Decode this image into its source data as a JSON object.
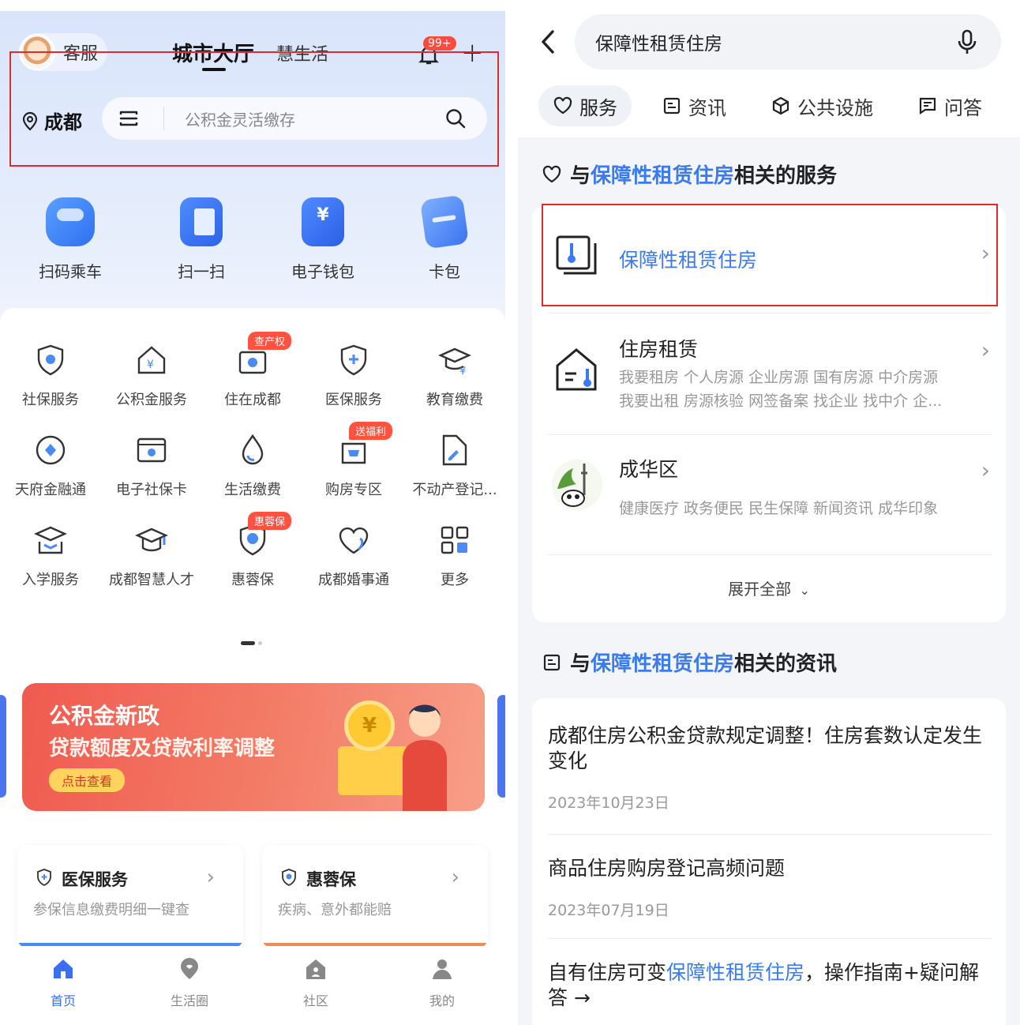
{
  "left": {
    "kefu_label": "客服",
    "tabs": {
      "city": "城市大厅",
      "life": "慧生活"
    },
    "badge": "99+",
    "city": "成都",
    "search_placeholder": "公积金灵活缴存",
    "quick": [
      "扫码乘车",
      "扫一扫",
      "电子钱包",
      "卡包"
    ],
    "grid": [
      [
        {
          "label": "社保服务"
        },
        {
          "label": "公积金服务"
        },
        {
          "label": "住在成都",
          "badge": "查产权"
        },
        {
          "label": "医保服务"
        },
        {
          "label": "教育缴费"
        }
      ],
      [
        {
          "label": "天府金融通"
        },
        {
          "label": "电子社保卡"
        },
        {
          "label": "生活缴费"
        },
        {
          "label": "购房专区",
          "badge": "送福利"
        },
        {
          "label": "不动产登记..."
        }
      ],
      [
        {
          "label": "入学服务"
        },
        {
          "label": "成都智慧人才"
        },
        {
          "label": "惠蓉保",
          "badge": "惠蓉保"
        },
        {
          "label": "成都婚事通"
        },
        {
          "label": "更多"
        }
      ]
    ],
    "banner": {
      "title": "公积金新政",
      "subtitle": "贷款额度及贷款利率调整",
      "button": "点击查看",
      "coin": "¥"
    },
    "cards": [
      {
        "title": "医保服务",
        "sub": "参保信息缴费明细一键查",
        "bar_color": "#4a8af4"
      },
      {
        "title": "惠蓉保",
        "sub": "疾病、意外都能赔",
        "bar_color": "#f08a5a"
      }
    ],
    "tabbar": [
      "首页",
      "生活圈",
      "社区",
      "我的"
    ]
  },
  "right": {
    "query": "保障性租赁住房",
    "tabs": [
      "服务",
      "资讯",
      "公共设施",
      "问答"
    ],
    "svc_section": {
      "prefix": "与",
      "hl": "保障性租赁住房",
      "suffix": "相关的服务"
    },
    "services": [
      {
        "title": "保障性租赁住房"
      },
      {
        "title": "住房租赁",
        "sub1": "我要租房 个人房源 企业房源 国有房源 中介房源",
        "sub2": "我要出租 房源核验 网签备案 找企业 找中介 企..."
      },
      {
        "title": "成华区",
        "sub1": "健康医疗 政务便民 民生保障 新闻资讯 成华印象"
      }
    ],
    "expand": "展开全部",
    "news_section": {
      "prefix": "与",
      "hl": "保障性租赁住房",
      "suffix": "相关的资讯"
    },
    "news": [
      {
        "title": "成都住房公积金贷款规定调整！住房套数认定发生变化",
        "date": "2023年10月23日"
      },
      {
        "title": "商品住房购房登记高频问题",
        "date": "2023年07月19日"
      },
      {
        "title_pre": "自有住房可变",
        "title_hl": "保障性租赁住房",
        "title_post": "，操作指南+疑问解答 →"
      }
    ],
    "accent": "#3a7af2"
  }
}
